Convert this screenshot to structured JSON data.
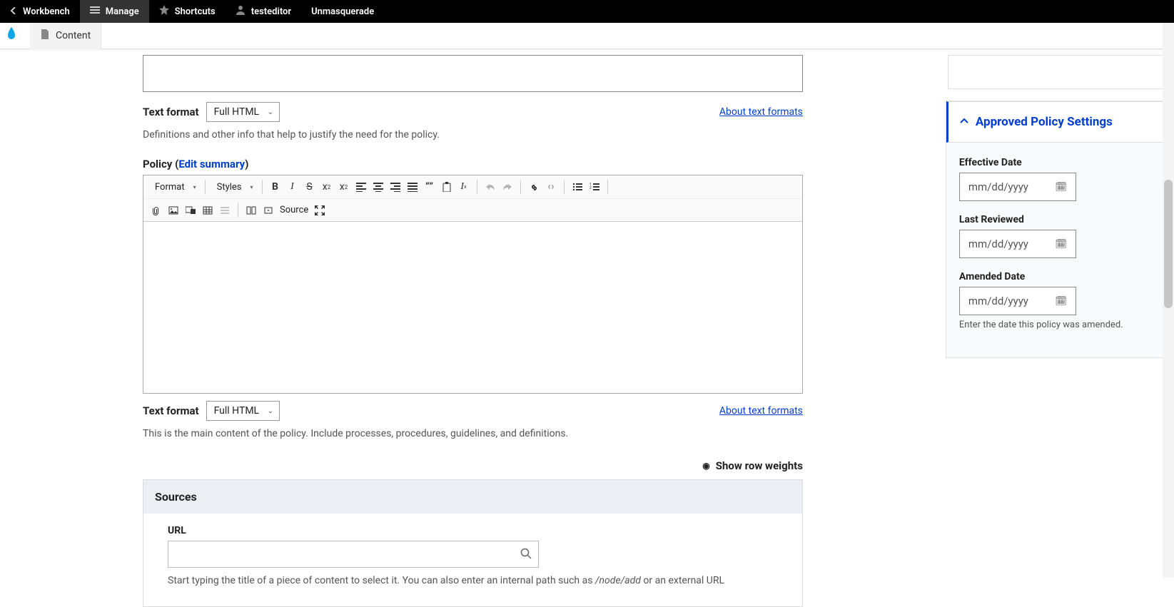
{
  "topbar": {
    "workbench": "Workbench",
    "manage": "Manage",
    "shortcuts": "Shortcuts",
    "user": "testeditor",
    "unmasquerade": "Unmasquerade"
  },
  "secondbar": {
    "content": "Content"
  },
  "format1": {
    "label": "Text format",
    "value": "Full HTML",
    "about": "About text formats",
    "help": "Definitions and other info that help to justify the need for the policy."
  },
  "policy": {
    "label_prefix": "Policy (",
    "edit_summary": "Edit summary",
    "label_suffix": ")",
    "toolbar": {
      "format": "Format",
      "styles": "Styles",
      "source": "Source"
    }
  },
  "format2": {
    "label": "Text format",
    "value": "Full HTML",
    "about": "About text formats",
    "help": "This is the main content of the policy. Include processes, procedures, guidelines, and definitions."
  },
  "row_weights": "Show row weights",
  "sources": {
    "title": "Sources",
    "url_label": "URL",
    "url_help_a": "Start typing the title of a piece of content to select it. You can also enter an internal path such as ",
    "url_help_em": "/node/add",
    "url_help_b": " or an external URL"
  },
  "sidebar": {
    "panel_title": "Approved Policy Settings",
    "effective_date": {
      "label": "Effective Date",
      "placeholder": "mm/dd/yyyy"
    },
    "last_reviewed": {
      "label": "Last Reviewed",
      "placeholder": "mm/dd/yyyy"
    },
    "amended_date": {
      "label": "Amended Date",
      "placeholder": "mm/dd/yyyy",
      "help": "Enter the date this policy was amended."
    }
  }
}
